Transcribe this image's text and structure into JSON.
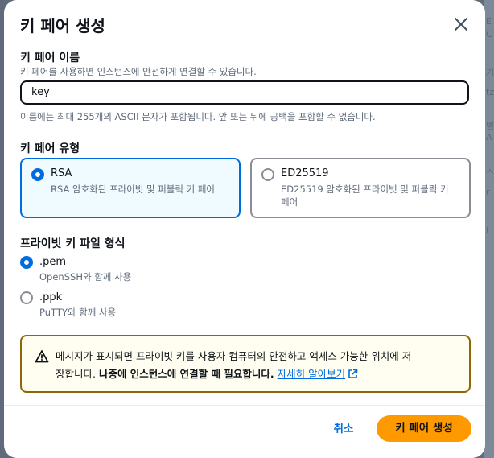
{
  "background": {
    "right_chars": [
      "E",
      "C",
      "기",
      "tz",
      "병",
      "A",
      "스",
      "r",
      "I"
    ]
  },
  "modal": {
    "title": "키 페어 생성",
    "close_icon": "close-icon"
  },
  "key_name": {
    "label": "키 페어 이름",
    "description": "키 페어를 사용하면 인스턴스에 안전하게 연결할 수 있습니다.",
    "value": "key",
    "constraint": "이름에는 최대 255개의 ASCII 문자가 포함됩니다. 앞 또는 뒤에 공백을 포함할 수 없습니다."
  },
  "key_type": {
    "label": "키 페어 유형",
    "options": [
      {
        "label": "RSA",
        "description": "RSA 암호화된 프라이빗 및 퍼블릭 키 페어",
        "selected": true
      },
      {
        "label": "ED25519",
        "description_line1": "ED25519 암호화된 프라이빗 및 퍼블릭 키",
        "description_line2": "페어",
        "selected": false
      }
    ]
  },
  "file_format": {
    "label": "프라이빗 키 파일 형식",
    "options": [
      {
        "label": ".pem",
        "description": "OpenSSH와 함께 사용",
        "selected": true
      },
      {
        "label": ".ppk",
        "description": "PuTTY와 함께 사용",
        "selected": false
      }
    ]
  },
  "alert": {
    "icon": "warning-icon",
    "text_line1": "메시지가 표시되면 프라이빗 키를 사용자 컴퓨터의 안전하고 액세스 가능한 위치에 저",
    "text_line2_plain": "장합니다. ",
    "text_line2_bold": "나중에 인스턴스에 연결할 때 필요합니다.",
    "link": "자세히 알아보기",
    "link_icon": "external-link-icon"
  },
  "footer": {
    "cancel": "취소",
    "submit": "키 페어 생성"
  },
  "colors": {
    "accent": "#006ce0",
    "primary_button": "#ff9900",
    "warning_border": "#8d6605"
  }
}
